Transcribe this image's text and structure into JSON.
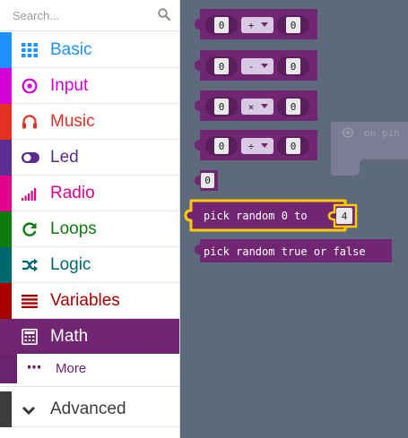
{
  "search": {
    "placeholder": "Search..."
  },
  "categories": [
    {
      "label": "Basic",
      "color": "#1e90ff",
      "icon": "grid-icon"
    },
    {
      "label": "Input",
      "color": "#d400d4",
      "icon": "target-icon"
    },
    {
      "label": "Music",
      "color": "#e63022",
      "icon": "headphones-icon"
    },
    {
      "label": "Led",
      "color": "#5c2d91",
      "icon": "toggle-icon"
    },
    {
      "label": "Radio",
      "color": "#e3008c",
      "icon": "signal-bars-icon"
    },
    {
      "label": "Loops",
      "color": "#107c10",
      "icon": "refresh-icon"
    },
    {
      "label": "Logic",
      "color": "#006970",
      "icon": "shuffle-icon"
    },
    {
      "label": "Variables",
      "color": "#a80000",
      "icon": "list-icon"
    },
    {
      "label": "Math",
      "color": "#712672",
      "icon": "calculator-icon",
      "selected": true
    }
  ],
  "more": {
    "label": "More",
    "icon": "ellipsis-icon"
  },
  "advanced": {
    "label": "Advanced",
    "icon": "chevron-down-icon"
  },
  "flyout": {
    "background": "#5d6a7c",
    "block_color": "#712672",
    "arith_blocks": [
      {
        "left": "0",
        "op": "+",
        "right": "0"
      },
      {
        "left": "0",
        "op": "-",
        "right": "0"
      },
      {
        "left": "0",
        "op": "×",
        "right": "0"
      },
      {
        "left": "0",
        "op": "÷",
        "right": "0"
      }
    ],
    "number_block": "0",
    "random_block": {
      "text": "pick random 0 to",
      "value": "4"
    },
    "random_bool_block": "pick random true or false",
    "workspace_block": {
      "text": "on pin"
    }
  }
}
